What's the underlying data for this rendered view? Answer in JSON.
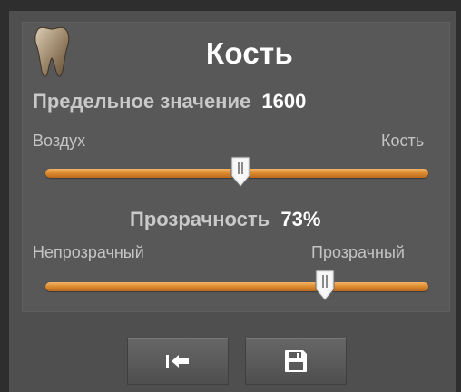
{
  "panel": {
    "title": "Кость",
    "threshold": {
      "label": "Предельное значение",
      "value": "1600",
      "left_label": "Воздух",
      "right_label": "Кость",
      "position_fraction": 0.51
    },
    "transparency": {
      "label": "Прозрачность",
      "value": "73%",
      "left_label": "Непрозрачный",
      "right_label": "Прозрачный",
      "position_fraction": 0.73
    }
  },
  "buttons": [
    {
      "icon": "reset-to-start-icon"
    },
    {
      "icon": "save-icon"
    }
  ],
  "colors": {
    "track": "#d8862b",
    "panel": "#585858",
    "text": "#ffffff"
  }
}
